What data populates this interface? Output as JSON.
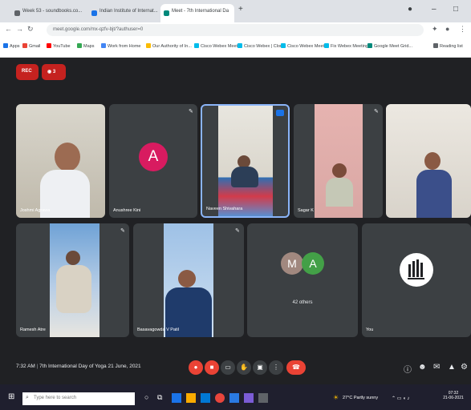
{
  "browser": {
    "tabs": [
      {
        "label": "Week 53 - soundbooks.co...",
        "favicon_color": "#5f6368"
      },
      {
        "label": "Indian Institute of Internat...",
        "favicon_color": "#1a73e8"
      },
      {
        "label": "Meet - 7th International Da",
        "favicon_color": "#00897b"
      }
    ],
    "new_tab": "+",
    "url": "meet.google.com/mx-qzfv-bjt/?authuser=0",
    "bookmarks": [
      {
        "label": "Apps",
        "color": "#1a73e8"
      },
      {
        "label": "Gmail",
        "color": "#ea4335"
      },
      {
        "label": "YouTube",
        "color": "#ff0000"
      },
      {
        "label": "Maps",
        "color": "#34a853"
      },
      {
        "label": "Work from Home",
        "color": "#4285f4"
      },
      {
        "label": "Our Authority of In...",
        "color": "#fbbc04"
      },
      {
        "label": "Cisco Webex Meeti...",
        "color": "#00bceb"
      },
      {
        "label": "Cisco Webex | Clou...",
        "color": "#00bceb"
      },
      {
        "label": "Cisco Webex Meeti...",
        "color": "#00bceb"
      },
      {
        "label": "Fix Webex Meeting...",
        "color": "#00bceb"
      },
      {
        "label": "Google Meet Grid...",
        "color": "#00897b"
      },
      {
        "label": "Reading list",
        "color": "#5f6368"
      }
    ]
  },
  "meet": {
    "rec_label": "REC",
    "viewer_count": "3",
    "participants": [
      {
        "name": "Joshmi Agrawa",
        "type": "video"
      },
      {
        "name": "Anushree Kini",
        "type": "avatar",
        "initial": "A",
        "avatar_color": "#d81b60"
      },
      {
        "name": "Naveen Shivahara",
        "type": "video",
        "active": true
      },
      {
        "name": "Sagar K",
        "type": "video"
      },
      {
        "name": "",
        "type": "video"
      },
      {
        "name": "Ramesh Atre",
        "type": "video"
      },
      {
        "name": "Basavagowda V Patil",
        "type": "video"
      },
      {
        "name": "42 others",
        "type": "others",
        "initials": [
          "M",
          "A"
        ]
      },
      {
        "name": "You",
        "type": "logo"
      }
    ],
    "time": "7:32 AM",
    "meeting_title": "7th International Day of Yoga 21 June, 2021"
  },
  "taskbar": {
    "search_placeholder": "Type here to search",
    "weather": "27°C Partly sunny",
    "clock_time": "07:32",
    "clock_date": "21-06-2021"
  }
}
